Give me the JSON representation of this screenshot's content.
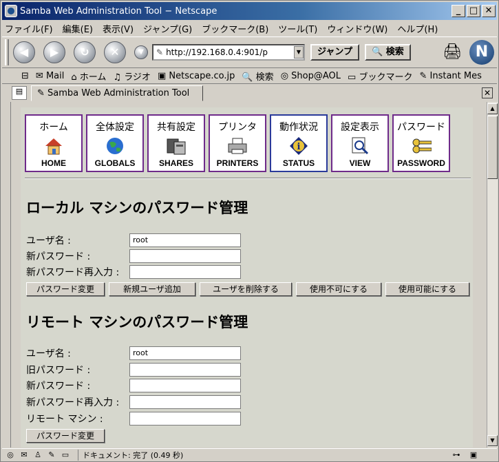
{
  "window": {
    "title": "Samba Web Administration Tool − Netscape"
  },
  "menu": [
    "ファイル(F)",
    "編集(E)",
    "表示(V)",
    "ジャンプ(G)",
    "ブックマーク(B)",
    "ツール(T)",
    "ウィンドウ(W)",
    "ヘルプ(H)"
  ],
  "toolbar": {
    "url": "http://192.168.0.4:901/p",
    "go_label": "ジャンプ",
    "search_label": "検索"
  },
  "personal": [
    "Mail",
    "ホーム",
    "ラジオ",
    "Netscape.co.jp",
    "検索",
    "Shop@AOL",
    "ブックマーク",
    "Instant Mes"
  ],
  "tab": {
    "label": "Samba Web Administration Tool"
  },
  "nav": [
    {
      "jp": "ホーム",
      "en": "HOME",
      "icon": "home-icon"
    },
    {
      "jp": "全体設定",
      "en": "GLOBALS",
      "icon": "globe-icon"
    },
    {
      "jp": "共有設定",
      "en": "SHARES",
      "icon": "shares-icon"
    },
    {
      "jp": "プリンタ",
      "en": "PRINTERS",
      "icon": "printer-icon"
    },
    {
      "jp": "動作状況",
      "en": "STATUS",
      "icon": "info-icon"
    },
    {
      "jp": "設定表示",
      "en": "VIEW",
      "icon": "view-icon"
    },
    {
      "jp": "パスワード",
      "en": "PASSWORD",
      "icon": "key-icon"
    }
  ],
  "local": {
    "heading": "ローカル マシンのパスワード管理",
    "user_label": "ユーザ名 :",
    "user_value": "root",
    "newpw_label": "新パスワード :",
    "repw_label": "新パスワード再入力 :",
    "buttons": [
      "パスワード変更",
      "新規ユーザ追加",
      "ユーザを削除する",
      "使用不可にする",
      "使用可能にする"
    ]
  },
  "remote": {
    "heading": "リモート マシンのパスワード管理",
    "user_label": "ユーザ名 :",
    "user_value": "root",
    "oldpw_label": "旧パスワード :",
    "newpw_label": "新パスワード :",
    "repw_label": "新パスワード再入力 :",
    "machine_label": "リモート マシン :",
    "button": "パスワード変更"
  },
  "status": {
    "text": "ドキュメント: 完了 (0.49 秒)"
  }
}
